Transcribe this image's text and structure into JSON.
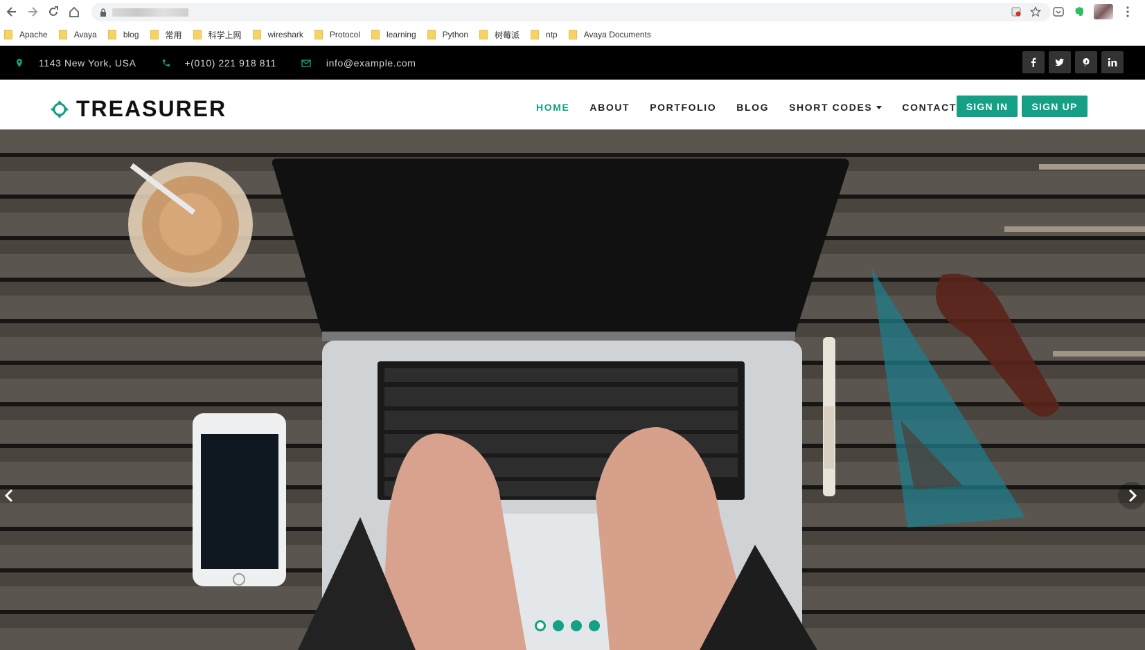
{
  "bookmarks": [
    "Apache",
    "Avaya",
    "blog",
    "常用",
    "科学上网",
    "wireshark",
    "Protocol",
    "learning",
    "Python",
    "树莓派",
    "ntp",
    "Avaya Documents"
  ],
  "topbar": {
    "address": "1143 New York, USA",
    "phone": "+(010) 221 918 811",
    "email": "info@example.com"
  },
  "header": {
    "logo_text": "TREASURER",
    "nav": {
      "home": "HOME",
      "about": "ABOUT",
      "portfolio": "PORTFOLIO",
      "blog": "BLOG",
      "shortcodes": "SHORT CODES",
      "contact": "CONTACT"
    },
    "signin": "SIGN IN",
    "signup": "SIGN UP"
  },
  "colors": {
    "accent": "#13a085",
    "topbar_bg": "#000000"
  },
  "hero": {
    "slides_count": 4,
    "active_slide": 1
  }
}
